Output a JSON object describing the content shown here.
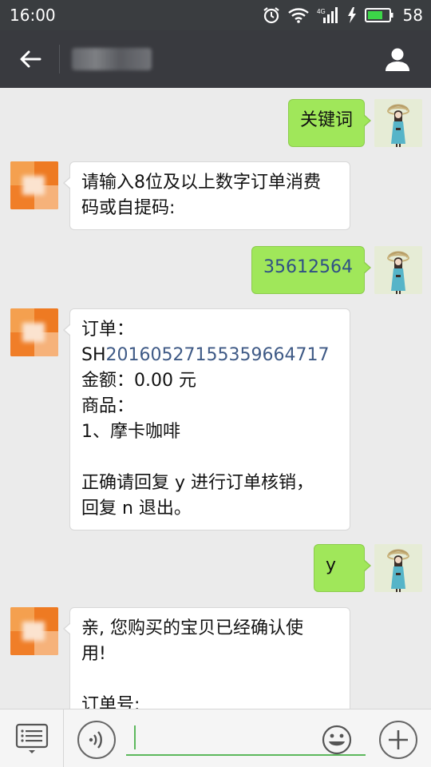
{
  "status_bar": {
    "time": "16:00",
    "network_label": "4G",
    "battery_percent": "58",
    "icons": [
      "alarm-icon",
      "wifi-icon",
      "signal-icon",
      "charging-icon",
      "battery-icon"
    ]
  },
  "header": {
    "title": "",
    "back_icon": "arrow-left-icon",
    "profile_icon": "person-icon"
  },
  "messages": [
    {
      "side": "out",
      "text": "关键词"
    },
    {
      "side": "in",
      "lines": [
        "请输入8位及以上数字订单消费",
        "码或自提码:"
      ]
    },
    {
      "side": "out",
      "text": "35612564"
    },
    {
      "side": "in",
      "l1": "订单：",
      "l2_prefix": "SH",
      "l2_number": "2016052715535966471​7",
      "l3": "金额：0.00 元",
      "l4": "商品：",
      "l5": "1、摩卡咖啡",
      "l6": "正确请回复 y 进行订单核销，",
      "l7": "回复 n 退出。"
    },
    {
      "side": "out",
      "text": "y"
    },
    {
      "side": "in",
      "lines": [
        "亲, 您购买的宝贝已经确认使",
        "用!",
        "",
        "订单号:"
      ]
    }
  ],
  "input_bar": {
    "placeholder": "",
    "menu_icon": "list-icon",
    "voice_icon": "voice-icon",
    "emoji_icon": "emoji-icon",
    "plus_icon": "plus-icon"
  },
  "colors": {
    "header_bg": "#393a3f",
    "chat_bg": "#ebebeb",
    "outgoing_bubble": "#a0e75a",
    "incoming_bubble": "#ffffff",
    "input_underline": "#5cb85c"
  }
}
